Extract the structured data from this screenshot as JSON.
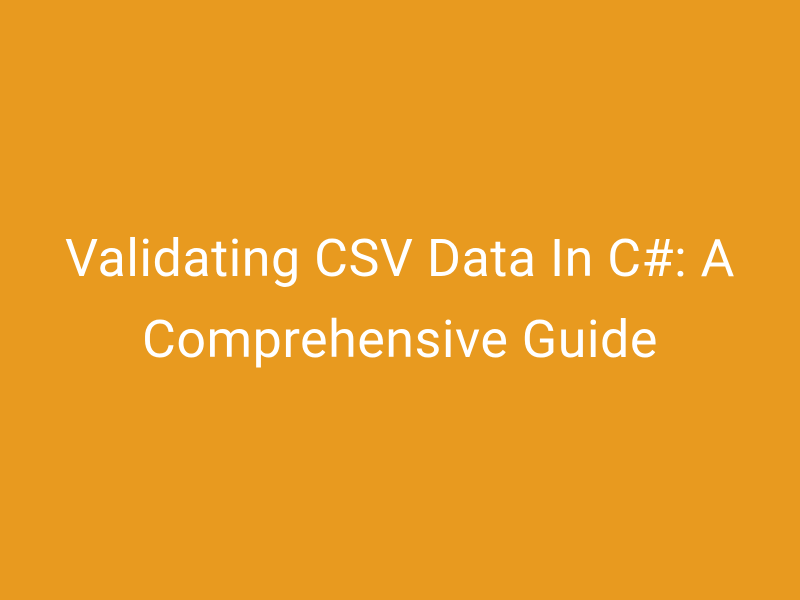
{
  "title": "Validating CSV Data In C#: A Comprehensive Guide",
  "colors": {
    "background": "#e89a1f",
    "text": "#ffffff"
  }
}
